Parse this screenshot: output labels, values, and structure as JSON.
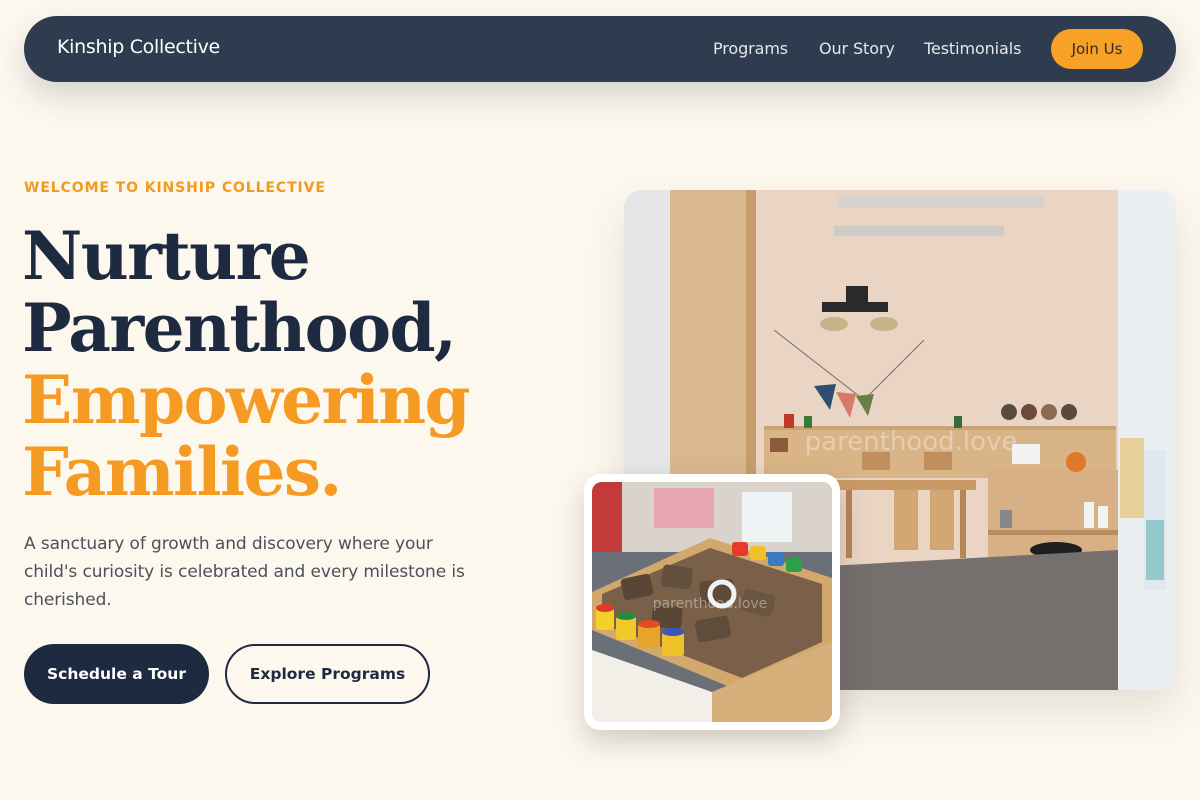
{
  "nav": {
    "brand": "Kinship Collective",
    "links": [
      {
        "label": "Programs"
      },
      {
        "label": "Our Story"
      },
      {
        "label": "Testimonials"
      }
    ],
    "cta": "Join Us"
  },
  "hero": {
    "eyebrow": "WELCOME TO KINSHIP COLLECTIVE",
    "headline": {
      "line1": "Nurture",
      "line2": "Parenthood,",
      "line3": "Empowering",
      "line4": "Families."
    },
    "subtext": "A sanctuary of growth and discovery where your child's curiosity is celebrated and every milestone is cherished.",
    "primary_button": "Schedule a Tour",
    "secondary_button": "Explore Programs"
  },
  "images": {
    "main": {
      "watermark": "parenthood.love",
      "subject": "classroom-photo"
    },
    "secondary": {
      "watermark": "parenthood.love",
      "subject": "wooden-letters-and-playdough-photo"
    }
  },
  "colors": {
    "background": "#fdf8ee",
    "nav_background": "#2f3b4e",
    "accent": "#f59a22",
    "dark": "#1e2a40"
  }
}
